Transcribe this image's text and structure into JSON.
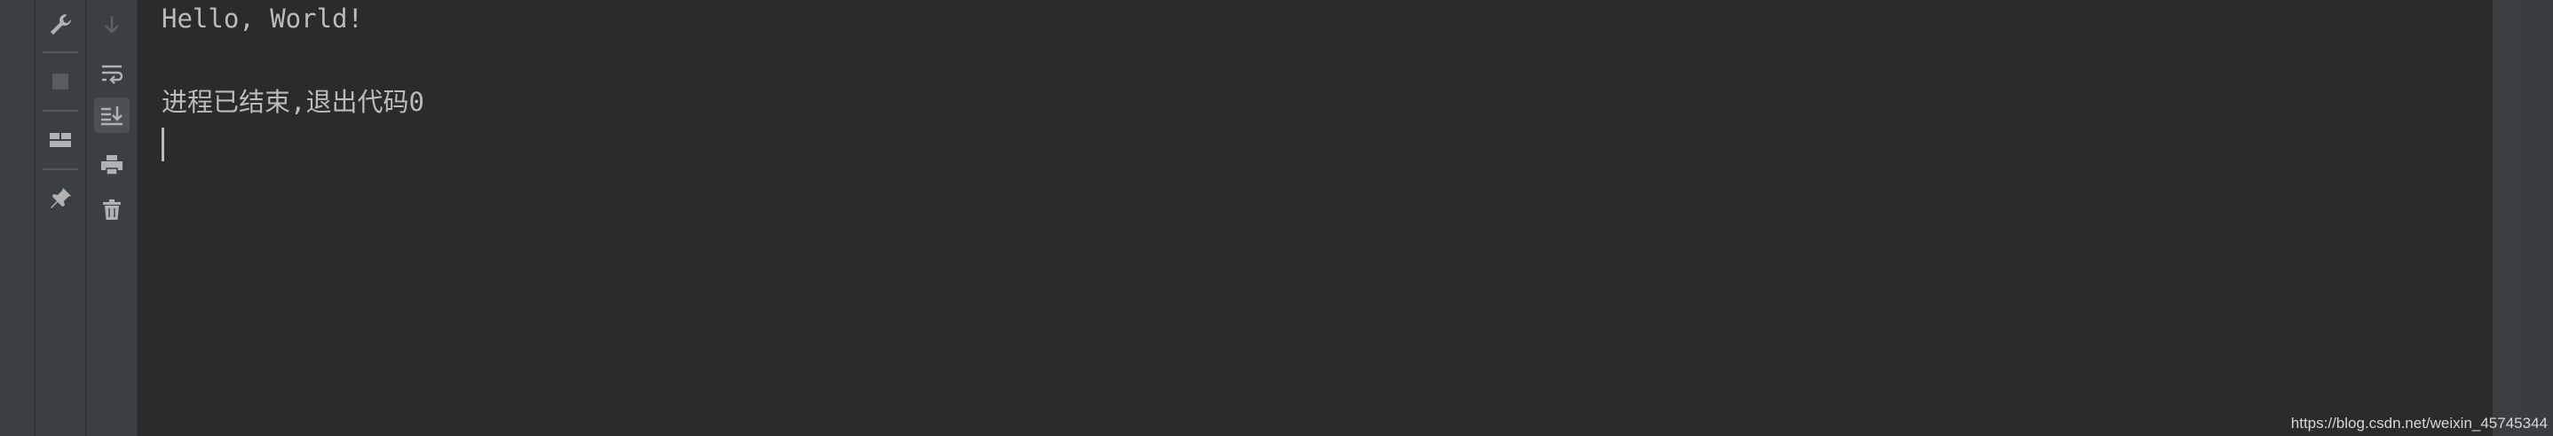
{
  "toolbar_left": [
    {
      "icon": "wrench-icon",
      "label": "Edit configuration"
    },
    {
      "icon": "stop-icon",
      "label": "Stop"
    },
    {
      "icon": "layout-icon",
      "label": "Restore layout"
    },
    {
      "icon": "pin-icon",
      "label": "Pin tab"
    }
  ],
  "toolbar_right": [
    {
      "icon": "arrow-down-icon",
      "label": "Down",
      "disabled": true
    },
    {
      "icon": "soft-wrap-icon",
      "label": "Soft-wrap"
    },
    {
      "icon": "scroll-to-end-icon",
      "label": "Scroll to the end",
      "active": true
    },
    {
      "icon": "print-icon",
      "label": "Print"
    },
    {
      "icon": "trash-icon",
      "label": "Clear all"
    }
  ],
  "console": {
    "lines": [
      "Hello, World!",
      "",
      "进程已结束,退出代码0"
    ]
  },
  "watermark": "https://blog.csdn.net/weixin_45745344",
  "colors": {
    "background": "#2b2b2b",
    "panel": "#3c3f41",
    "text": "#bbbbbb",
    "icon": "#afb1b3"
  }
}
